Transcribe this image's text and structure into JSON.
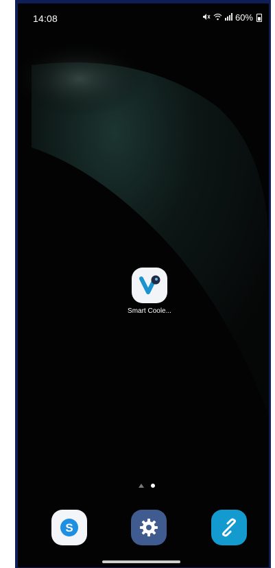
{
  "status_bar": {
    "time": "14:08",
    "battery_percent": "60%",
    "icons": [
      "mute-icon",
      "wifi-icon",
      "signal-icon",
      "battery-icon"
    ]
  },
  "home_screen": {
    "apps": [
      {
        "label": "Smart Coole...",
        "icon": "smart-cooler-app-icon"
      }
    ],
    "page_indicator": {
      "pages": 2,
      "current": 2
    }
  },
  "dock": {
    "apps": [
      {
        "icon": "skype-icon",
        "accent": "#1e8fe1"
      },
      {
        "icon": "settings-icon",
        "accent": "#3f5b8f"
      },
      {
        "icon": "link-sharing-icon",
        "accent": "#139bd0"
      }
    ]
  }
}
